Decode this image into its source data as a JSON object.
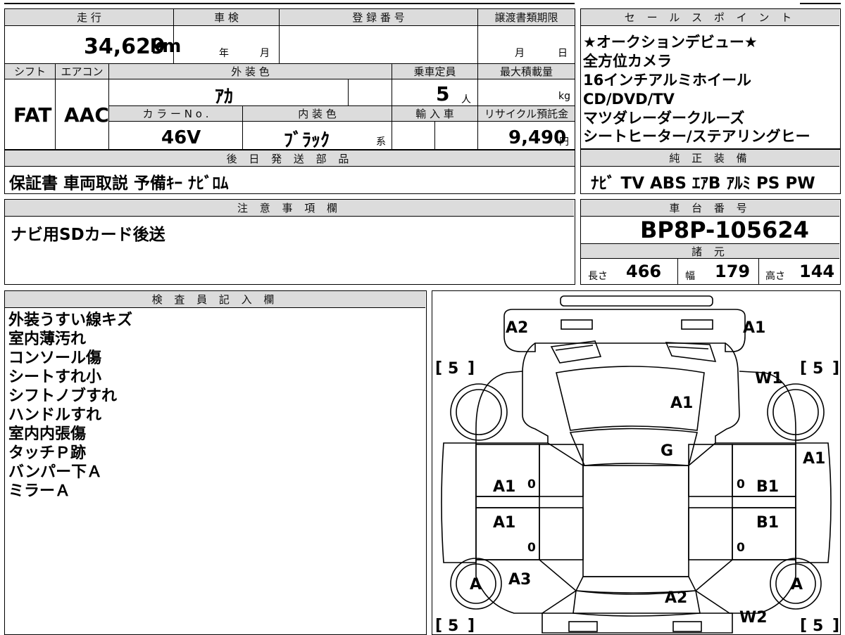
{
  "header": {
    "mileage": "走 行",
    "inspection": "車 検",
    "registration": "登 録 番 号",
    "transfer_deadline": "譲渡書類期限",
    "shift": "シフト",
    "aircon": "エアコン",
    "exterior_color": "外 装 色",
    "capacity": "乗車定員",
    "max_load": "最大積載量",
    "color_no": "カ ラ ー N o .",
    "interior_color": "内 装 色",
    "import": "輸 入 車",
    "recycle": "リサイクル預託金",
    "later_parts": "後 日 発 送 部 品",
    "notes": "注 意 事 項 欄",
    "inspector": "検 査 員 記 入 欄",
    "sales_points": "セ ー ル ス ポ イ ン ト",
    "genuine_equipment": "純 正 装 備",
    "chassis": "車 台 番 号",
    "specs": "諸 元"
  },
  "values": {
    "mileage": "34,629",
    "mileage_unit": "km",
    "inspection_year": "年",
    "inspection_month": "月",
    "transfer_month": "月",
    "transfer_day": "日",
    "shift": "FAT",
    "aircon": "AAC",
    "exterior_color": "ｱｶ",
    "capacity": "5",
    "capacity_unit": "人",
    "max_load_unit": "kg",
    "color_no": "46V",
    "interior_color": "ﾌﾞﾗｯｸ",
    "interior_suffix": "系",
    "recycle": "9,490",
    "recycle_unit": "円",
    "later_parts": "保証書 車両取説 予備ｷｰ ﾅﾋﾞﾛﾑ",
    "notes": "ナビ用SDカード後送",
    "chassis": "BP8P-105624",
    "length_label": "長さ",
    "length": "466",
    "width_label": "幅",
    "width": "179",
    "height_label": "高さ",
    "height": "144",
    "genuine_equipment": "ﾅﾋﾞ TV ABS ｴｱB ｱﾙﾐ PS PW"
  },
  "sales_points": [
    "★オークションデビュー★",
    "全方位カメラ",
    "16インチアルミホイール",
    "CD/DVD/TV",
    "マツダレーダークルーズ",
    "シートヒーター/ステアリングヒー"
  ],
  "inspector_notes": [
    "外装うすい線キズ",
    "室内薄汚れ",
    "コンソール傷",
    "シートすれ小",
    "シフトノブすれ",
    "ハンドルすれ",
    "室内内張傷",
    "タッチＰ跡",
    "バンパー下Ａ",
    "ミラーＡ"
  ],
  "diagram": {
    "front_left": "A2",
    "front_right": "A1",
    "hood": "A1",
    "windshield": "G",
    "tire_fl": "5",
    "tire_fr": "5",
    "tire_rl": "5",
    "tire_rr": "5",
    "wheel_front_right": "W1",
    "fender_right": "A1",
    "door_left_front": "A1",
    "door_left_rear": "A1",
    "door_right_front": "B1",
    "door_right_rear": "B1",
    "wheel_left_rear": "A",
    "wheel_right_rear": "A",
    "rear_quarter_left": "A3",
    "trunk": "A2",
    "wheel_rear_right": "W2",
    "tire_bracket_open": "[",
    "tire_bracket_close": "]",
    "door_zero": "0"
  }
}
